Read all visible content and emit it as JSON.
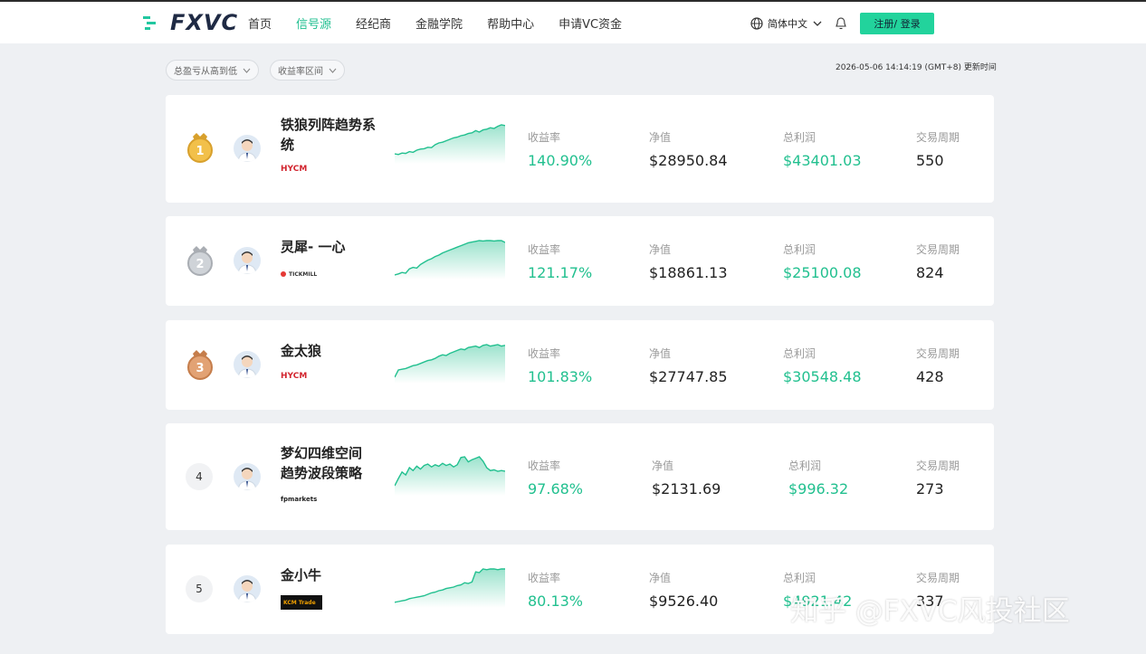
{
  "header": {
    "logo_text": "FXVC",
    "nav": [
      "首页",
      "信号源",
      "经纪商",
      "金融学院",
      "帮助中心",
      "申请VC资金"
    ],
    "active_nav": "信号源",
    "language": "简体中文",
    "register_login": "注册/ 登录"
  },
  "filters": {
    "sort": "总盈亏从高到低",
    "range": "收益率区间"
  },
  "update": {
    "time": "2026-05-06 14:14:19",
    "tz": "(GMT+8)",
    "label": "更新时间"
  },
  "labels": {
    "return": "收益率",
    "nav": "净值",
    "profit": "总利润",
    "period": "交易周期"
  },
  "signals": [
    {
      "rank": "1",
      "name": "铁狼列阵趋势系统",
      "broker": "HYCM",
      "return": "140.90%",
      "nav": "$28950.84",
      "profit": "$43401.03",
      "period": "550",
      "curve": [
        20,
        18,
        22,
        21,
        26,
        24,
        30,
        33,
        34,
        38,
        37,
        45,
        50,
        52,
        56,
        60,
        64,
        66,
        70,
        72,
        76,
        78,
        84,
        80,
        86,
        88,
        92,
        90,
        96,
        100,
        98
      ]
    },
    {
      "rank": "2",
      "name": "灵犀- 一心",
      "broker": "TICKMILL",
      "return": "121.17%",
      "nav": "$18861.13",
      "profit": "$25100.08",
      "period": "824",
      "curve": [
        5,
        8,
        12,
        10,
        22,
        26,
        24,
        34,
        40,
        46,
        50,
        56,
        60,
        66,
        70,
        74,
        78,
        82,
        86,
        90,
        94,
        96,
        98,
        100,
        99,
        100,
        100,
        99,
        100,
        100,
        95
      ]
    },
    {
      "rank": "3",
      "name": "金太狼",
      "broker": "HYCM",
      "return": "101.83%",
      "nav": "$27747.85",
      "profit": "$30548.48",
      "period": "428",
      "curve": [
        10,
        30,
        32,
        34,
        38,
        42,
        44,
        48,
        52,
        56,
        58,
        62,
        68,
        72,
        70,
        76,
        80,
        84,
        88,
        86,
        92,
        94,
        96,
        92,
        98,
        100,
        96,
        98,
        100,
        96,
        98
      ]
    },
    {
      "rank": "4",
      "name": "梦幻四维空间趋势波段策略",
      "broker": "fpmarkets",
      "return": "97.68%",
      "nav": "$2131.69",
      "profit": "$996.32",
      "period": "273",
      "curve": [
        20,
        40,
        58,
        50,
        70,
        62,
        74,
        66,
        76,
        80,
        72,
        78,
        74,
        82,
        76,
        80,
        72,
        78,
        98,
        100,
        86,
        92,
        96,
        100,
        88,
        70,
        62,
        64,
        60,
        62,
        60
      ]
    },
    {
      "rank": "5",
      "name": "金小牛",
      "broker": "KCM Trade",
      "return": "80.13%",
      "nav": "$9526.40",
      "profit": "$4921.42",
      "period": "337",
      "curve": [
        8,
        10,
        12,
        14,
        18,
        20,
        22,
        24,
        26,
        30,
        34,
        36,
        40,
        42,
        46,
        48,
        50,
        54,
        56,
        62,
        60,
        64,
        92,
        90,
        100,
        98,
        100,
        100,
        98,
        100,
        100
      ]
    }
  ],
  "watermark": "知乎 @FXVC风投社区",
  "colors": {
    "accent": "#22c08f",
    "button": "#22d39c"
  }
}
